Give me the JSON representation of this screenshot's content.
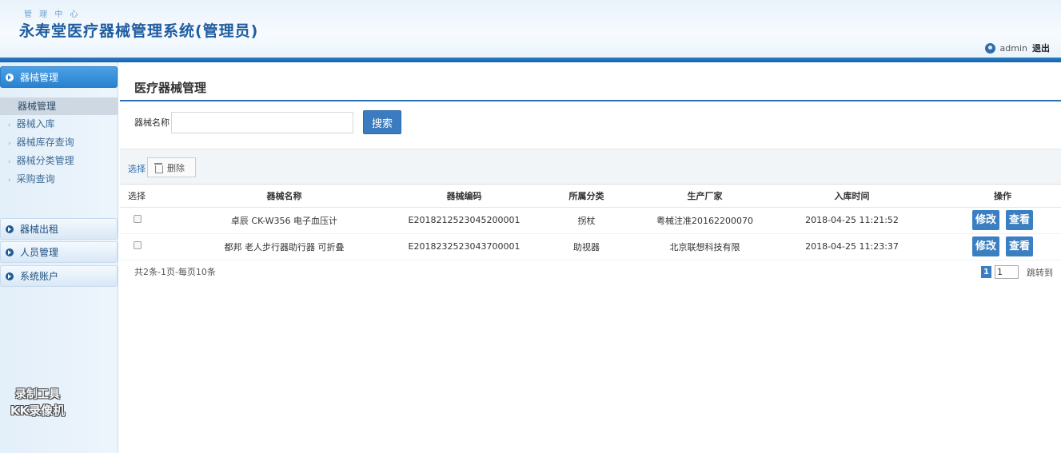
{
  "header": {
    "sub_title": "管 理 中 心",
    "title": "永寿堂医疗器械管理系统(管理员)",
    "user": "admin",
    "logout": "退出"
  },
  "sidebar": {
    "group_equipment": "器械管理",
    "sub_head": "器械管理",
    "items": [
      {
        "label": "器械入库"
      },
      {
        "label": "器械库存查询"
      },
      {
        "label": "器械分类管理"
      },
      {
        "label": "采购查询"
      }
    ],
    "group_rent": "器械出租",
    "group_staff": "人员管理",
    "group_account": "系统账户"
  },
  "watermark": {
    "line1": "录制工具",
    "line2": "KK录像机"
  },
  "main": {
    "title": "医疗器械管理",
    "search_label": "器械名称",
    "search_value": "",
    "search_button": "搜索",
    "select_link": "选择",
    "delete_button": "删除",
    "columns": [
      "选择",
      "器械名称",
      "器械编码",
      "所属分类",
      "生产厂家",
      "入库时间",
      "操作"
    ],
    "rows": [
      {
        "name": "卓辰 CK-W356 电子血压计",
        "code": "E2018212523045200001",
        "category": "拐杖",
        "maker": "粤械注准20162200070",
        "time": "2018-04-25 11:21:52",
        "edit": "修改",
        "view": "查看"
      },
      {
        "name": "都邦 老人步行器助行器 可折叠",
        "code": "E2018232523043700001",
        "category": "助视器",
        "maker": "北京联想科技有限",
        "time": "2018-04-25 11:23:37",
        "edit": "修改",
        "view": "查看"
      }
    ],
    "pager_info": "共2条-1页-每页10条",
    "current_page": "1",
    "page_input": "1",
    "jump_label": "跳转到"
  }
}
